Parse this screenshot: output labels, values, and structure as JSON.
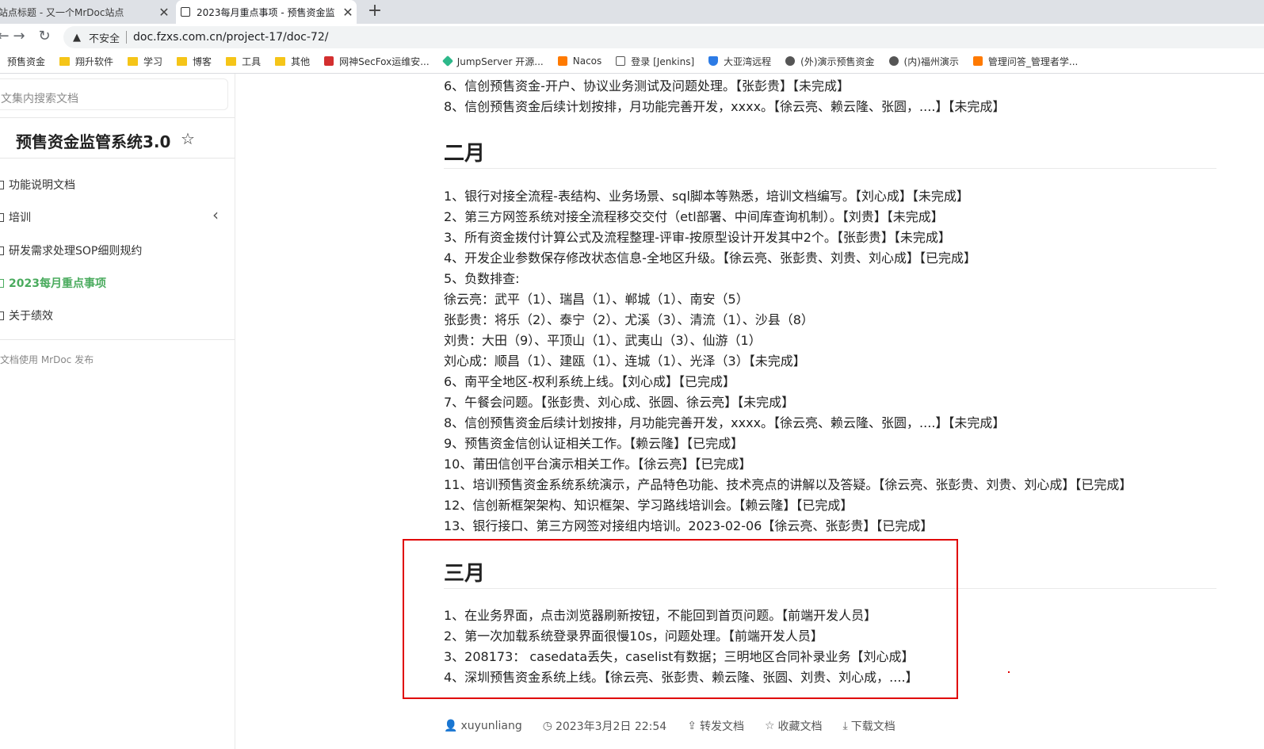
{
  "tabs": [
    {
      "title": "站点标题 - 又一个MrDoc站点",
      "close": "✕"
    },
    {
      "title": "2023每月重点事项 - 预售资金监",
      "close": "✕"
    }
  ],
  "new_tab_label": "+",
  "toolbar": {
    "back": "←",
    "forward": "→",
    "reload": "↻",
    "security_label": "不安全",
    "url": "doc.fzxs.com.cn/project-17/doc-72/"
  },
  "bookmarks": [
    {
      "label": "预售资金",
      "icon": "none"
    },
    {
      "label": "翔升软件",
      "icon": "folder"
    },
    {
      "label": "学习",
      "icon": "folder"
    },
    {
      "label": "博客",
      "icon": "folder"
    },
    {
      "label": "工具",
      "icon": "folder"
    },
    {
      "label": "其他",
      "icon": "folder"
    },
    {
      "label": "网神SecFox运维安...",
      "icon": "red"
    },
    {
      "label": "JumpServer 开源...",
      "icon": "green"
    },
    {
      "label": "Nacos",
      "icon": "orange"
    },
    {
      "label": "登录 [Jenkins]",
      "icon": "doc"
    },
    {
      "label": "大亚湾远程",
      "icon": "shield"
    },
    {
      "label": "(外)演示预售资金",
      "icon": "globe"
    },
    {
      "label": "(内)福州演示",
      "icon": "globe"
    },
    {
      "label": "管理问答_管理者学...",
      "icon": "orange"
    }
  ],
  "sidebar": {
    "search_placeholder": "文集内搜索文档",
    "project_title": "预售资金监管系统3.0",
    "star_icon": "☆",
    "items": [
      {
        "label": "功能说明文档"
      },
      {
        "label": "培训"
      },
      {
        "label": "研发需求处理SOP细则规约"
      },
      {
        "label": "2023每月重点事项"
      },
      {
        "label": "关于绩效"
      }
    ],
    "powered_by": "文档使用 MrDoc 发布"
  },
  "doc": {
    "jan_tail": [
      "6、信创预售资金-开户、协议业务测试及问题处理。【张彭贵】【未完成】",
      "8、信创预售资金后续计划按排，月功能完善开发，xxxx。【徐云亮、赖云隆、张圆，....】【未完成】"
    ],
    "feb_title": "二月",
    "feb_items": [
      "1、银行对接全流程-表结构、业务场景、sql脚本等熟悉，培训文档编写。【刘心成】【未完成】",
      "2、第三方网签系统对接全流程移交交付（etl部署、中间库查询机制）。【刘贵】【未完成】",
      "3、所有资金拨付计算公式及流程整理-评审-按原型设计开发其中2个。【张彭贵】【未完成】",
      "4、开发企业参数保存修改状态信息-全地区升级。【徐云亮、张彭贵、刘贵、刘心成】【已完成】",
      "5、负数排查:",
      "徐云亮：武平（1）、瑞昌（1）、郸城（1）、南安（5）",
      "张彭贵：将乐（2）、泰宁（2）、尤溪（3）、清流（1）、沙县（8）",
      "刘贵：大田（9）、平顶山（1）、武夷山（3）、仙游（1）",
      "刘心成：顺昌（1）、建瓯（1）、连城（1）、光泽（3）【未完成】",
      "6、南平全地区-权利系统上线。【刘心成】【已完成】",
      "7、午餐会问题。【张彭贵、刘心成、张圆、徐云亮】【未完成】",
      "8、信创预售资金后续计划按排，月功能完善开发，xxxx。【徐云亮、赖云隆、张圆，....】【未完成】",
      "9、预售资金信创认证相关工作。【赖云隆】【已完成】",
      "10、莆田信创平台演示相关工作。【徐云亮】【已完成】",
      "11、培训预售资金系统系统演示，产品特色功能、技术亮点的讲解以及答疑。【徐云亮、张彭贵、刘贵、刘心成】【已完成】",
      "12、信创新框架架构、知识框架、学习路线培训会。【赖云隆】【已完成】",
      "13、银行接口、第三方网签对接组内培训。2023-02-06【徐云亮、张彭贵】【已完成】"
    ],
    "mar_title": "三月",
    "mar_items": [
      "1、在业务界面，点击浏览器刷新按钮，不能回到首页问题。【前端开发人员】",
      "2、第一次加载系统登录界面很慢10s，问题处理。【前端开发人员】",
      "3、208173： casedata丢失，caselist有数据；三明地区合同补录业务【刘心成】",
      "4、深圳预售资金系统上线。【徐云亮、张彭贵、赖云隆、张圆、刘贵、刘心成，....】"
    ]
  },
  "footer": {
    "author": "xuyunliang",
    "date": "2023年3月2日 22:54",
    "share": "转发文档",
    "collect": "收藏文档",
    "download": "下载文档"
  },
  "colors": {
    "active_green": "#4aab5e",
    "highlight_red": "#e00000"
  }
}
